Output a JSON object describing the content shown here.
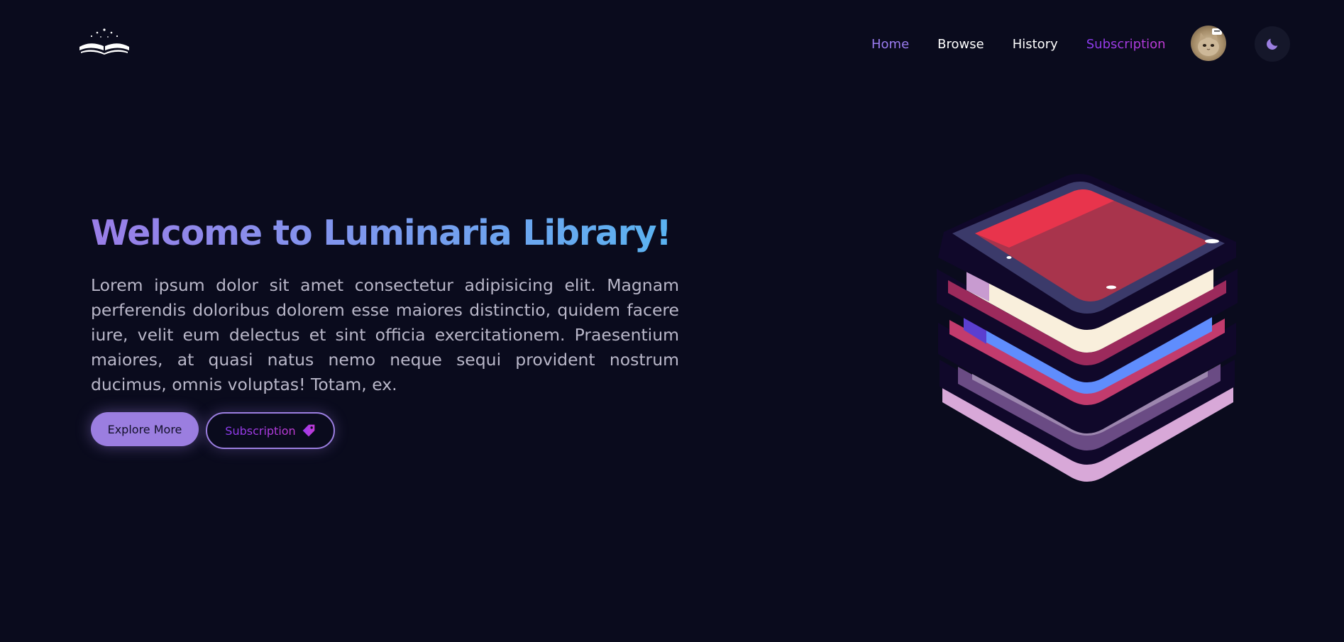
{
  "nav": {
    "items": [
      {
        "label": "Home",
        "active": true
      },
      {
        "label": "Browse"
      },
      {
        "label": "History"
      },
      {
        "label": "Subscription"
      }
    ]
  },
  "icons": {
    "logo": "open-book-stars-logo",
    "avatar": "user-avatar-cat",
    "theme": "moon-icon",
    "tag": "price-tag-icon",
    "hero": "stacked-books-illustration"
  },
  "hero": {
    "title": "Welcome to Luminaria Library!",
    "text": "Lorem ipsum dolor sit amet consectetur adipisicing elit. Magnam perferendis doloribus dolorem esse maiores distinctio, quidem facere iure, velit eum delectus et sint officia exercitationem. Praesentium maiores, at quasi natus nemo neque sequi provident nostrum ducimus, omnis voluptas! Totam, ex.",
    "explore_label": "Explore More",
    "subscription_label": "Subscription"
  },
  "colors": {
    "background": "#0a0b1d",
    "accent": "#9b7ee0",
    "title_gradient_start": "#9a7ee8",
    "title_gradient_end": "#5ab3f0",
    "subscription_gradient_start": "#8a3bf0",
    "subscription_gradient_end": "#c23bd3"
  }
}
